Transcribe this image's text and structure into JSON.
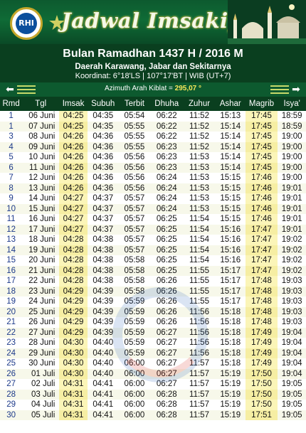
{
  "banner": {
    "title": "Jadwal Imsakiyah",
    "logo_text": "RHI",
    "logo_arc": "RAHASYA HILALA ISLAM"
  },
  "header": {
    "title": "Bulan Ramadhan 1437 H / 2016 M",
    "region": "Daerah Karawang, Jabar dan Sekitarnya",
    "coords": "Koordinat: 6°18'LS | 107°17'BT | WIB (UT+7)"
  },
  "qibla": {
    "label": "Azimuth Arah Kiblat =",
    "value": "295,07 °"
  },
  "table": {
    "columns": [
      "Rmd",
      "Tgl",
      "Imsak",
      "Subuh",
      "Terbit",
      "Dhuha",
      "Zuhur",
      "Ashar",
      "Magrib",
      "Isya'"
    ],
    "rows": [
      [
        "1",
        "06 Juni",
        "04:25",
        "04:35",
        "05:54",
        "06:22",
        "11:52",
        "15:13",
        "17:45",
        "18:59"
      ],
      [
        "1",
        "07 Juni",
        "04:25",
        "04:35",
        "05:55",
        "06:22",
        "11:52",
        "15:14",
        "17:45",
        "18:59"
      ],
      [
        "3",
        "08 Juni",
        "04:26",
        "04:36",
        "05:55",
        "06:22",
        "11:52",
        "15:14",
        "17:45",
        "19:00"
      ],
      [
        "4",
        "09 Juni",
        "04:26",
        "04:36",
        "05:55",
        "06:23",
        "11:52",
        "15:14",
        "17:45",
        "19:00"
      ],
      [
        "5",
        "10 Juni",
        "04:26",
        "04:36",
        "05:56",
        "06:23",
        "11:53",
        "15:14",
        "17:45",
        "19:00"
      ],
      [
        "6",
        "11 Juni",
        "04:26",
        "04:36",
        "05:56",
        "06:23",
        "11:53",
        "15:14",
        "17:45",
        "19:00"
      ],
      [
        "7",
        "12 Juni",
        "04:26",
        "04:36",
        "05:56",
        "06:24",
        "11:53",
        "15:15",
        "17:46",
        "19:00"
      ],
      [
        "8",
        "13 Juni",
        "04:26",
        "04:36",
        "05:56",
        "06:24",
        "11:53",
        "15:15",
        "17:46",
        "19:01"
      ],
      [
        "9",
        "14 Juni",
        "04:27",
        "04:37",
        "05:57",
        "06:24",
        "11:53",
        "15:15",
        "17:46",
        "19:01"
      ],
      [
        "10",
        "15 Juni",
        "04:27",
        "04:37",
        "05:57",
        "06:24",
        "11:53",
        "15:15",
        "17:46",
        "19:01"
      ],
      [
        "11",
        "16 Juni",
        "04:27",
        "04:37",
        "05:57",
        "06:25",
        "11:54",
        "15:15",
        "17:46",
        "19:01"
      ],
      [
        "12",
        "17 Juni",
        "04:27",
        "04:37",
        "05:57",
        "06:25",
        "11:54",
        "15:16",
        "17:47",
        "19:01"
      ],
      [
        "13",
        "18 Juni",
        "04:28",
        "04:38",
        "05:57",
        "06:25",
        "11:54",
        "15:16",
        "17:47",
        "19:02"
      ],
      [
        "14",
        "19 Juni",
        "04:28",
        "04:38",
        "05:57",
        "06:25",
        "11:54",
        "15:16",
        "17:47",
        "19:02"
      ],
      [
        "15",
        "20 Juni",
        "04:28",
        "04:38",
        "05:58",
        "06:25",
        "11:54",
        "15:16",
        "17:47",
        "19:02"
      ],
      [
        "16",
        "21 Juni",
        "04:28",
        "04:38",
        "05:58",
        "06:25",
        "11:55",
        "15:17",
        "17:47",
        "19:02"
      ],
      [
        "17",
        "22 Juni",
        "04:28",
        "04:38",
        "05:58",
        "06:26",
        "11:55",
        "15:17",
        "17:48",
        "19:03"
      ],
      [
        "18",
        "23 Juni",
        "04:29",
        "04:39",
        "05:58",
        "06:26",
        "11:55",
        "15:17",
        "17:48",
        "19:03"
      ],
      [
        "19",
        "24 Juni",
        "04:29",
        "04:39",
        "05:59",
        "06:26",
        "11:55",
        "15:17",
        "17:48",
        "19:03"
      ],
      [
        "20",
        "25 Juni",
        "04:29",
        "04:39",
        "05:59",
        "06:26",
        "11:56",
        "15:18",
        "17:48",
        "19:03"
      ],
      [
        "21",
        "26 Juni",
        "04:29",
        "04:39",
        "05:59",
        "06:26",
        "11:56",
        "15:18",
        "17:48",
        "19:03"
      ],
      [
        "22",
        "27 Juni",
        "04:29",
        "04:39",
        "05:59",
        "06:27",
        "11:56",
        "15:18",
        "17:49",
        "19:04"
      ],
      [
        "23",
        "28 Juni",
        "04:30",
        "04:40",
        "05:59",
        "06:27",
        "11:56",
        "15:18",
        "17:49",
        "19:04"
      ],
      [
        "24",
        "29 Juni",
        "04:30",
        "04:40",
        "05:59",
        "06:27",
        "11:56",
        "15:18",
        "17:49",
        "19:04"
      ],
      [
        "25",
        "30 Juni",
        "04:30",
        "04:40",
        "06:00",
        "06:27",
        "11:57",
        "15:18",
        "17:49",
        "19:04"
      ],
      [
        "26",
        "01 Juli",
        "04:30",
        "04:40",
        "06:00",
        "06:27",
        "11:57",
        "15:19",
        "17:50",
        "19:04"
      ],
      [
        "27",
        "02 Juli",
        "04:31",
        "04:41",
        "06:00",
        "06:27",
        "11:57",
        "15:19",
        "17:50",
        "19:05"
      ],
      [
        "28",
        "03 Juli",
        "04:31",
        "04:41",
        "06:00",
        "06:28",
        "11:57",
        "15:19",
        "17:50",
        "19:05"
      ],
      [
        "29",
        "04 Juli",
        "04:31",
        "04:41",
        "06:00",
        "06:28",
        "11:57",
        "15:19",
        "17:50",
        "19:05"
      ],
      [
        "30",
        "05 Juli",
        "04:31",
        "04:41",
        "06:00",
        "06:28",
        "11:57",
        "15:19",
        "17:51",
        "19:05"
      ]
    ]
  }
}
